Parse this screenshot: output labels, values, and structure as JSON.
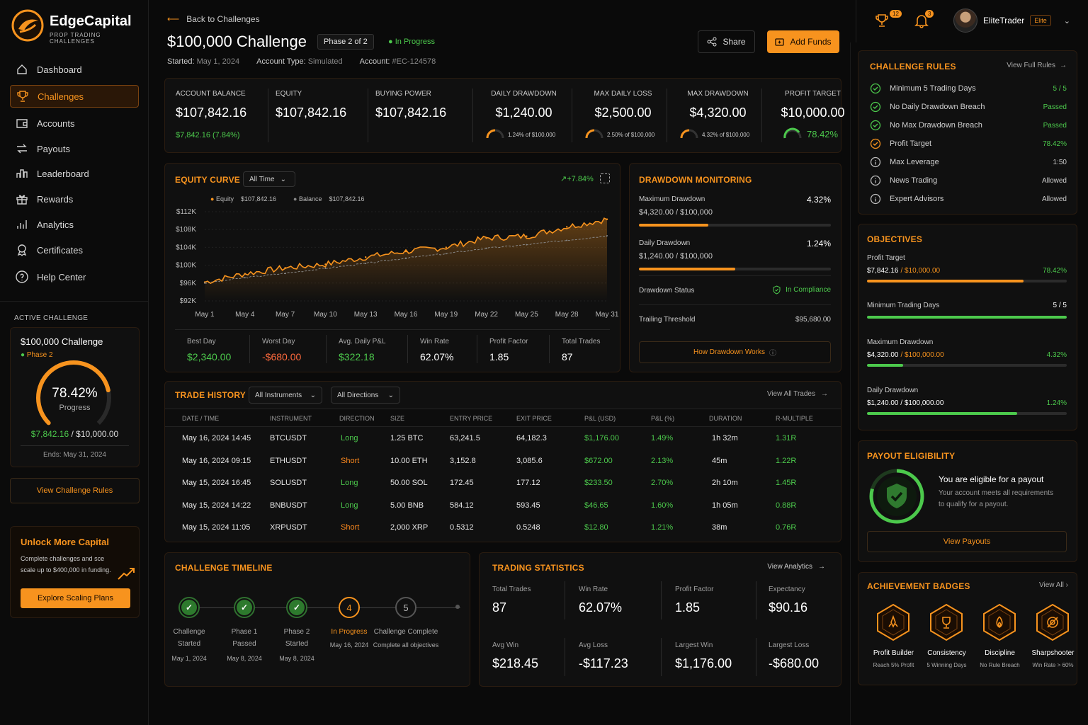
{
  "brand": {
    "name": "EdgeCapital",
    "tagline": "PROP TRADING CHALLENGES"
  },
  "sidebar": {
    "items": [
      {
        "label": "Dashboard",
        "icon": "home-icon"
      },
      {
        "label": "Challenges",
        "icon": "trophy-icon"
      },
      {
        "label": "Accounts",
        "icon": "wallet-icon"
      },
      {
        "label": "Payouts",
        "icon": "payout-icon"
      },
      {
        "label": "Leaderboard",
        "icon": "leaderboard-icon"
      },
      {
        "label": "Rewards",
        "icon": "gift-icon"
      },
      {
        "label": "Analytics",
        "icon": "analytics-icon"
      },
      {
        "label": "Certificates",
        "icon": "certificate-icon"
      },
      {
        "label": "Help Center",
        "icon": "help-icon"
      }
    ],
    "active_heading": "ACTIVE CHALLENGE",
    "active": {
      "name": "$100,000 Challenge",
      "phase": "Phase 2",
      "progress_pct": "78.42%",
      "progress_label": "Progress",
      "progress_value": 0.7842,
      "current": "$7,842.16",
      "target": "/ $10,000.00",
      "ends": "Ends: May 31, 2024"
    },
    "view_rules": "View Challenge Rules",
    "unlock": {
      "title": "Unlock More Capital",
      "text1": "Complete challenges and sce",
      "text2": "scale up to $400,000 in funding.",
      "button": "Explore Scaling Plans"
    }
  },
  "header": {
    "back": "Back to Challenges",
    "title": "$100,000 Challenge",
    "phase": "Phase 2 of 2",
    "status": "In Progress",
    "started_label": "Started:",
    "started": "May 1, 2024",
    "type_label": "Account Type:",
    "type": "Simulated",
    "account_label": "Account:",
    "account": "#EC-124578",
    "share": "Share",
    "add_funds": "Add Funds"
  },
  "topbar": {
    "trophy_count": "12",
    "bell_count": "3",
    "user": "EliteTrader",
    "tier": "Elite"
  },
  "kpis": {
    "balance": {
      "label": "ACCOUNT BALANCE",
      "value": "$107,842.16",
      "sub": "$7,842.16 (7.84%)"
    },
    "equity": {
      "label": "EQUITY",
      "value": "$107,842.16"
    },
    "buying": {
      "label": "BUYING POWER",
      "value": "$107,842.16"
    },
    "daily_dd": {
      "label": "DAILY DRAWDOWN",
      "value": "$1,240.00",
      "sub": "1.24% of $100,000"
    },
    "max_daily": {
      "label": "MAX DAILY LOSS",
      "value": "$2,500.00",
      "sub": "2.50% of $100,000"
    },
    "max_dd": {
      "label": "MAX DRAWDOWN",
      "value": "$4,320.00",
      "sub": "4.32% of $100,000"
    },
    "profit": {
      "label": "PROFIT TARGET",
      "value": "$10,000.00",
      "sub": "78.42%"
    }
  },
  "equity_curve": {
    "title": "EQUITY CURVE",
    "range": "All Time",
    "change": "+7.84%",
    "legend_equity": "Equity",
    "legend_equity_val": "$107,842.16",
    "legend_balance": "Balance",
    "legend_balance_val": "$107,842.16",
    "stats": [
      {
        "label": "Best Day",
        "value": "$2,340.00",
        "color": "green"
      },
      {
        "label": "Worst Day",
        "value": "-$680.00",
        "color": "red"
      },
      {
        "label": "Avg. Daily P&L",
        "value": "$322.18",
        "color": "green"
      },
      {
        "label": "Win Rate",
        "value": "62.07%",
        "color": "white"
      },
      {
        "label": "Profit Factor",
        "value": "1.85",
        "color": "white"
      },
      {
        "label": "Total Trades",
        "value": "87",
        "color": "white"
      }
    ]
  },
  "chart_data": {
    "type": "line",
    "title": "EQUITY CURVE",
    "x": [
      "May 1",
      "May 4",
      "May 7",
      "May 10",
      "May 13",
      "May 16",
      "May 19",
      "May 22",
      "May 25",
      "May 28",
      "May 31"
    ],
    "y_ticks": [
      "$112K",
      "$108K",
      "$104K",
      "$100K",
      "$96K",
      "$92K"
    ],
    "ylim": [
      92000,
      112000
    ],
    "series": [
      {
        "name": "Equity",
        "color": "#f7931e",
        "values": [
          96200,
          98100,
          99400,
          100200,
          101800,
          103100,
          104000,
          106100,
          106500,
          108600,
          110300
        ]
      },
      {
        "name": "Balance",
        "color": "#888888",
        "values": [
          96000,
          97200,
          98200,
          99300,
          100400,
          101600,
          102600,
          103800,
          104600,
          105600,
          106600
        ]
      }
    ]
  },
  "drawdown": {
    "title": "DRAWDOWN MONITORING",
    "max": {
      "label": "Maximum Drawdown",
      "value": "$4,320.00 / $100,000",
      "pct": "4.32%",
      "fill": 0.36
    },
    "daily": {
      "label": "Daily Drawdown",
      "value": "$1,240.00 / $100,000",
      "pct": "1.24%",
      "fill": 0.5
    },
    "status_label": "Drawdown Status",
    "status": "In Compliance",
    "trailing_label": "Trailing Threshold",
    "trailing": "$95,680.00",
    "button": "How Drawdown Works"
  },
  "trades": {
    "title": "TRADE HISTORY",
    "filter1": "All Instruments",
    "filter2": "All Directions",
    "view_all": "View All Trades",
    "headers": [
      "DATE / TIME",
      "INSTRUMENT",
      "DIRECTION",
      "SIZE",
      "ENTRY PRICE",
      "EXIT PRICE",
      "P&L (USD)",
      "P&L (%)",
      "DURATION",
      "R-MULTIPLE"
    ],
    "rows": [
      [
        "May 16, 2024 14:45",
        "BTCUSDT",
        "Long",
        "1.25 BTC",
        "63,241.5",
        "64,182.3",
        "$1,176.00",
        "1.49%",
        "1h 32m",
        "1.31R"
      ],
      [
        "May 16, 2024 09:15",
        "ETHUSDT",
        "Short",
        "10.00 ETH",
        "3,152.8",
        "3,085.6",
        "$672.00",
        "2.13%",
        "45m",
        "1.22R"
      ],
      [
        "May 15, 2024 16:45",
        "SOLUSDT",
        "Long",
        "50.00 SOL",
        "172.45",
        "177.12",
        "$233.50",
        "2.70%",
        "2h 10m",
        "1.45R"
      ],
      [
        "May 15, 2024 14:22",
        "BNBUSDT",
        "Long",
        "5.00 BNB",
        "584.12",
        "593.45",
        "$46.65",
        "1.60%",
        "1h 05m",
        "0.88R"
      ],
      [
        "May 15, 2024 11:05",
        "XRPUSDT",
        "Short",
        "2,000 XRP",
        "0.5312",
        "0.5248",
        "$12.80",
        "1.21%",
        "38m",
        "0.76R"
      ]
    ]
  },
  "timeline": {
    "title": "CHALLENGE TIMELINE",
    "steps": [
      {
        "mark": "✓",
        "l1": "Challenge",
        "l2": "Started",
        "date": "May 1, 2024",
        "state": "done"
      },
      {
        "mark": "✓",
        "l1": "Phase 1",
        "l2": "Passed",
        "date": "May 8, 2024",
        "state": "done"
      },
      {
        "mark": "✓",
        "l1": "Phase 2",
        "l2": "Started",
        "date": "May 8, 2024",
        "state": "done"
      },
      {
        "mark": "4",
        "l1": "In Progress",
        "l2": "May 16, 2024",
        "date": "",
        "state": "current"
      },
      {
        "mark": "5",
        "l1": "Challenge Complete",
        "l2": "Complete all objectives",
        "date": "",
        "state": "pending"
      }
    ]
  },
  "trading_stats": {
    "title": "TRADING STATISTICS",
    "view": "View Analytics",
    "items": [
      {
        "label": "Total Trades",
        "value": "87"
      },
      {
        "label": "Win Rate",
        "value": "62.07%"
      },
      {
        "label": "Profit Factor",
        "value": "1.85"
      },
      {
        "label": "Expectancy",
        "value": "$90.16"
      },
      {
        "label": "Avg Win",
        "value": "$218.45"
      },
      {
        "label": "Avg Loss",
        "value": "-$117.23"
      },
      {
        "label": "Largest Win",
        "value": "$1,176.00"
      },
      {
        "label": "Largest Loss",
        "value": "-$680.00"
      }
    ]
  },
  "rules": {
    "title": "CHALLENGE RULES",
    "view": "View Full Rules",
    "items": [
      {
        "label": "Minimum 5 Trading Days",
        "value": "5 / 5",
        "state": "ok"
      },
      {
        "label": "No Daily Drawdown Breach",
        "value": "Passed",
        "state": "ok"
      },
      {
        "label": "No Max Drawdown Breach",
        "value": "Passed",
        "state": "ok"
      },
      {
        "label": "Profit Target",
        "value": "78.42%",
        "state": "progress"
      },
      {
        "label": "Max Leverage",
        "value": "1:50",
        "state": "info"
      },
      {
        "label": "News Trading",
        "value": "Allowed",
        "state": "info"
      },
      {
        "label": "Expert Advisors",
        "value": "Allowed",
        "state": "info"
      }
    ]
  },
  "objectives": {
    "title": "OBJECTIVES",
    "items": [
      {
        "label": "Profit Target",
        "v1": "$7,842.16",
        "v2": "/ $10,000.00",
        "pct": "78.42%",
        "fill": 0.7842,
        "color": "#f7931e"
      },
      {
        "label": "Minimum Trading Days",
        "v1": "",
        "v2": "",
        "pct": "5 / 5",
        "fill": 1,
        "color": "#4cc94c"
      },
      {
        "label": "Maximum Drawdown",
        "v1": "$4,320.00",
        "v2": "/ $100,000.00",
        "pct": "4.32%",
        "fill": 0.18,
        "color": "#4cc94c"
      },
      {
        "label": "Daily Drawdown",
        "v1": "$1,240.00 / $100,000.00",
        "v2": "",
        "pct": "1.24%",
        "fill": 0.75,
        "color": "#4cc94c"
      }
    ]
  },
  "payout": {
    "title": "PAYOUT ELIGIBILITY",
    "heading": "You are eligible for a payout",
    "text1": "Your account meets all requirements",
    "text2": "to qualify for a payout.",
    "button": "View Payouts"
  },
  "badges": {
    "title": "ACHIEVEMENT BADGES",
    "view": "View All",
    "items": [
      {
        "name": "Profit Builder",
        "desc": "Reach 5% Profit",
        "icon": "rocket-icon"
      },
      {
        "name": "Consistency",
        "desc": "5 Winning Days",
        "icon": "trophy-icon"
      },
      {
        "name": "Discipline",
        "desc": "No Rule Breach",
        "icon": "flame-icon"
      },
      {
        "name": "Sharpshooter",
        "desc": "Win Rate > 60%",
        "icon": "target-icon"
      }
    ]
  }
}
